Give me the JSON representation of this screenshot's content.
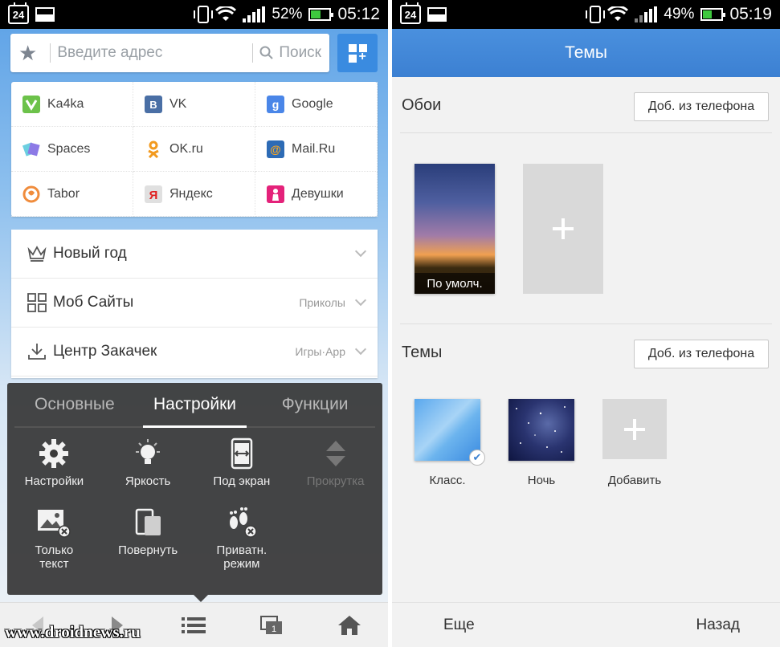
{
  "left": {
    "status": {
      "calendar_day": "24",
      "battery": "52%",
      "time": "05:12",
      "battery_level": 0.52
    },
    "address_bar": {
      "placeholder": "Введите адрес",
      "search_label": "Поиск"
    },
    "speed_dial": [
      {
        "label": "Ka4ka",
        "icon": "ka4ka-icon",
        "color": "#6cc24a"
      },
      {
        "label": "VK",
        "icon": "vk-icon",
        "color": "#4a6fa5"
      },
      {
        "label": "Google",
        "icon": "google-icon",
        "color": "#4a86e8"
      },
      {
        "label": "Spaces",
        "icon": "spaces-icon",
        "color": "#8c7ae6"
      },
      {
        "label": "OK.ru",
        "icon": "ok-icon",
        "color": "#f29a1f"
      },
      {
        "label": "Mail.Ru",
        "icon": "mail-icon",
        "color": "#2d6bb5"
      },
      {
        "label": "Tabor",
        "icon": "tabor-icon",
        "color": "#f08c3c"
      },
      {
        "label": "Яндекс",
        "icon": "yandex-icon",
        "color": "#e0e0e0"
      },
      {
        "label": "Девушки",
        "icon": "girls-icon",
        "color": "#e4227a"
      }
    ],
    "nav_list": [
      {
        "label": "Новый год",
        "sub": "",
        "icon": "crown-icon"
      },
      {
        "label": "Моб Сайты",
        "sub": "Приколы",
        "icon": "grid-icon"
      },
      {
        "label": "Центр Закачек",
        "sub": "Игры·App",
        "icon": "download-icon"
      }
    ],
    "menu": {
      "tabs": [
        "Основные",
        "Настройки",
        "Функции"
      ],
      "active_tab": 1,
      "items": [
        {
          "label": "Настройки",
          "icon": "gear-icon",
          "enabled": true
        },
        {
          "label": "Яркость",
          "icon": "bulb-icon",
          "enabled": true
        },
        {
          "label": "Под экран",
          "icon": "fit-screen-icon",
          "enabled": true
        },
        {
          "label": "Прокрутка",
          "icon": "scroll-icon",
          "enabled": false
        },
        {
          "label": "Только текст",
          "icon": "no-image-icon",
          "enabled": true
        },
        {
          "label": "Повернуть",
          "icon": "rotate-icon",
          "enabled": true
        },
        {
          "label": "Приватн. режим",
          "icon": "private-mode-icon",
          "enabled": true
        }
      ]
    },
    "watermark": "www.droidnews.ru"
  },
  "right": {
    "status": {
      "calendar_day": "24",
      "battery": "49%",
      "time": "05:19",
      "battery_level": 0.49
    },
    "title": "Темы",
    "wallpapers": {
      "title": "Обои",
      "add_button": "Доб. из телефона",
      "default_label": "По умолч."
    },
    "themes": {
      "title": "Темы",
      "add_button": "Доб. из телефона",
      "items": [
        {
          "label": "Класс.",
          "selected": true
        },
        {
          "label": "Ночь",
          "selected": false
        },
        {
          "label": "Добавить",
          "selected": false
        }
      ]
    },
    "bottom": {
      "more": "Еще",
      "back": "Назад"
    }
  }
}
